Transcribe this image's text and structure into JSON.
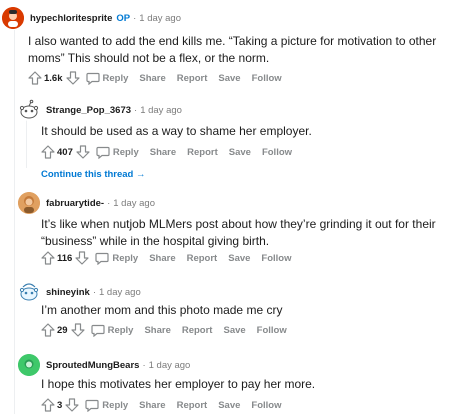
{
  "comments": [
    {
      "username": "hypechloritesprite",
      "op_badge": "OP",
      "time": "1 day ago",
      "text": "I also wanted to add the end kills me. “Taking a picture for motivation to other moms” This should not be a flex, or the norm.",
      "score": "1.6k",
      "avatar_color": "#d93a00"
    },
    {
      "username": "Strange_Pop_3673",
      "time": "1 day ago",
      "text": "It should be used as a way to shame her employer.",
      "score": "407",
      "avatar_color": "#ffffff"
    },
    {
      "username": "fabruarytide-",
      "time": "1 day ago",
      "text": "It’s like when nutjob MLMers post about how they’re grinding it out for their “business” while in the hospital giving birth.",
      "score": "116",
      "avatar_color": "#e0a060"
    },
    {
      "username": "shineyink",
      "time": "1 day ago",
      "text": "I’m another mom and this photo made me cry",
      "score": "29",
      "avatar_color": "#ffffff"
    },
    {
      "username": "SproutedMungBears",
      "time": "1 day ago",
      "text": "I hope this motivates her employer to pay her more.",
      "score": "3",
      "avatar_color": "#3ec86a"
    }
  ],
  "actions": {
    "reply": "Reply",
    "share": "Share",
    "report": "Report",
    "save": "Save",
    "follow": "Follow"
  },
  "continue_thread": "Continue this thread →",
  "separator": "·",
  "colors": {
    "op_blue": "#0079d3",
    "meta_gray": "#7c7c7c",
    "action_gray": "#878a8c"
  }
}
